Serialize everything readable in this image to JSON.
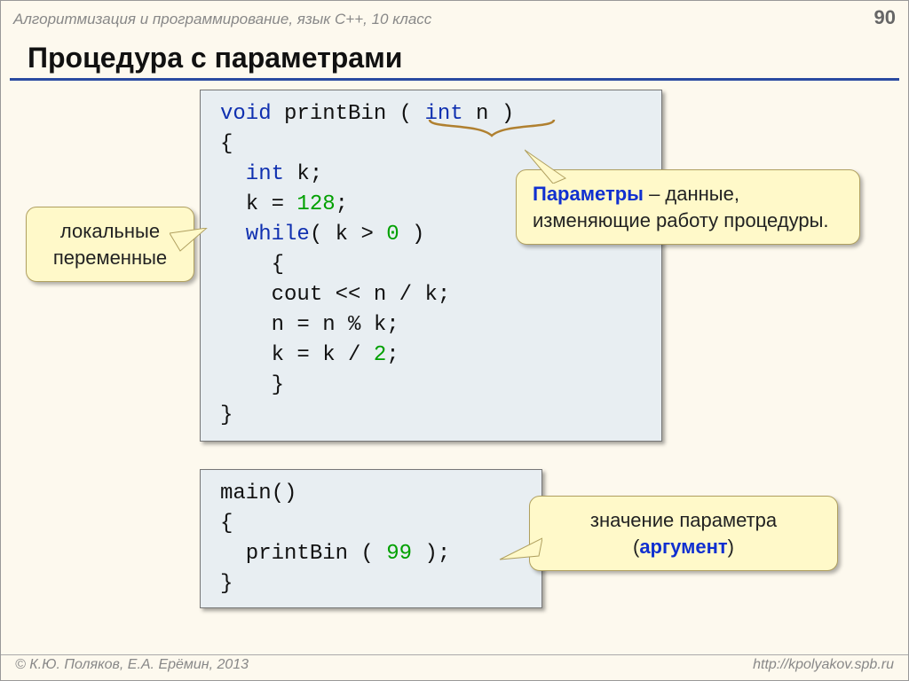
{
  "header": {
    "subject": "Алгоритмизация и программирование, язык  C++, 10 класс",
    "page_number": "90"
  },
  "title": "Процедура с параметрами",
  "code1": {
    "l1a": "void",
    "l1b": " printBin ( ",
    "l1c": "int",
    "l1d": " n )",
    "l2": "{",
    "l3a": "  int",
    "l3b": " k;",
    "l4a": "  k = ",
    "l4b": "128",
    "l4c": ";",
    "l5a": "  while",
    "l5b": "( k > ",
    "l5c": "0",
    "l5d": " )",
    "l6": "    {",
    "l7": "    cout << n / k;",
    "l8": "    n = n % k;",
    "l9a": "    k = k / ",
    "l9b": "2",
    "l9c": ";",
    "l10": "    }",
    "l11": "}"
  },
  "code2": {
    "l1": "main()",
    "l2": "{",
    "l3a": "  printBin ( ",
    "l3b": "99",
    "l3c": " );",
    "l4": "}"
  },
  "callouts": {
    "local": "локальные переменные",
    "params_hl": "Параметры",
    "params_rest": " – данные, изменяющие работу процедуры.",
    "arg_prefix": "значение параметра (",
    "arg_hl": "аргумент",
    "arg_suffix": ")"
  },
  "footer": {
    "left": "© К.Ю. Поляков, Е.А. Ерёмин, 2013",
    "right": "http://kpolyakov.spb.ru"
  }
}
